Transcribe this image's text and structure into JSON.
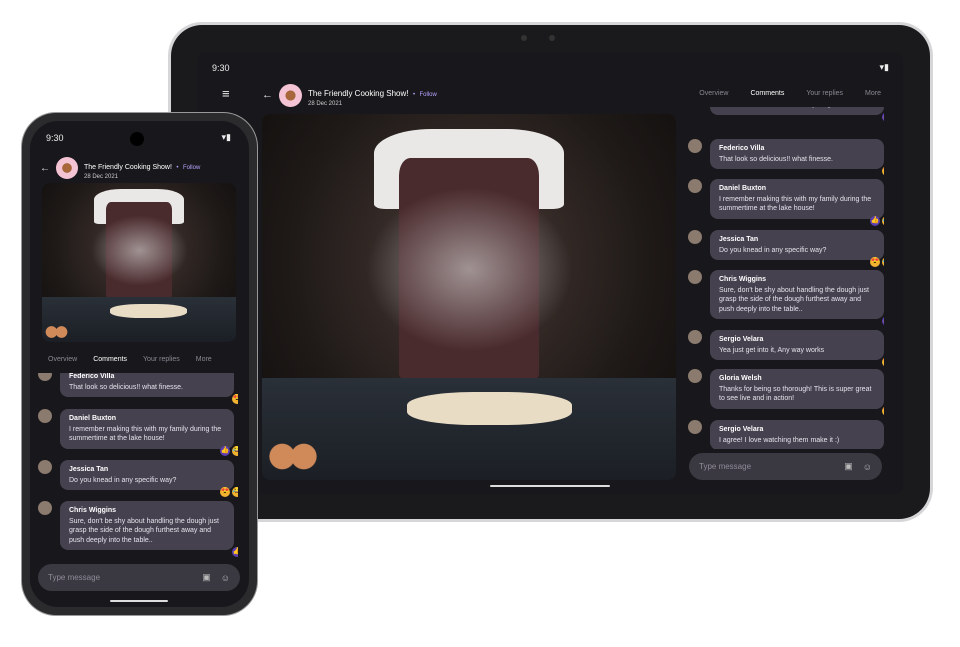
{
  "status": {
    "time": "9:30"
  },
  "header": {
    "title": "The Friendly Cooking Show!",
    "follow": "Follow",
    "date": "28  Dec 2021"
  },
  "tabs": [
    "Overview",
    "Comments",
    "Your replies",
    "More"
  ],
  "input": {
    "placeholder": "Type message"
  },
  "comments": [
    {
      "name": "",
      "text": "more or so, butter makes everything!!",
      "reactions": [
        "like"
      ]
    },
    {
      "name": "Federico Villa",
      "text": "That look so delicious!! what finesse.",
      "reactions": [
        "love"
      ]
    },
    {
      "name": "Daniel Buxton",
      "text": "I remember making this with my family during the summertime at the lake house!",
      "reactions": [
        "like",
        "laugh"
      ]
    },
    {
      "name": "Jessica Tan",
      "text": "Do you knead in any specific way?",
      "reactions": [
        "love",
        "laugh"
      ]
    },
    {
      "name": "Chris Wiggins",
      "text": "Sure, don't be shy about handling the dough just grasp the side of the dough furthest away and push deeply into the table..",
      "reactions": [
        "like"
      ]
    },
    {
      "name": "Sergio Velara",
      "text": "Yea just get into it, Any way works",
      "reactions": [
        "love"
      ]
    },
    {
      "name": "Gloria Welsh",
      "text": "Thanks for being so thorough! This is super great to see live and in action!",
      "reactions": [
        "love"
      ]
    },
    {
      "name": "Sergio Velara",
      "text": "I agree! I love watching them make it :)",
      "reactions": []
    }
  ]
}
